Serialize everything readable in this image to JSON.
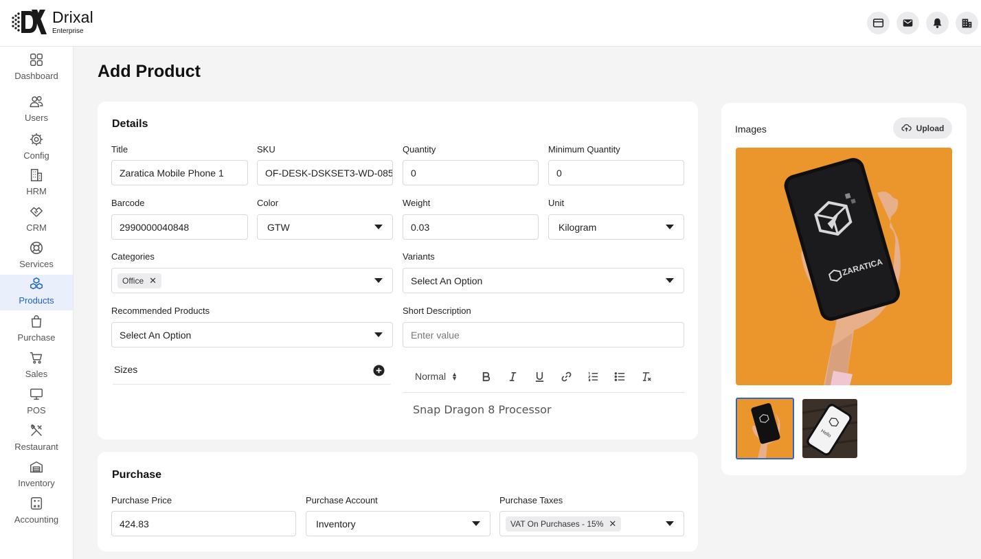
{
  "app": {
    "name": "Drixal",
    "edition": "Enterprise"
  },
  "top_icons": [
    "browser-window-icon",
    "mail-icon",
    "bell-icon",
    "company-building-icon"
  ],
  "sidebar": {
    "items": [
      {
        "label": "Dashboard",
        "icon": "dashboard-grid-icon"
      },
      {
        "label": "Users",
        "icon": "users-icon"
      },
      {
        "label": "Config",
        "icon": "config-gear-icon"
      },
      {
        "label": "HRM",
        "icon": "hrm-building-icon"
      },
      {
        "label": "CRM",
        "icon": "crm-handshake-icon"
      },
      {
        "label": "Services",
        "icon": "services-lifebuoy-icon"
      },
      {
        "label": "Products",
        "icon": "products-boxes-icon",
        "active": true
      },
      {
        "label": "Purchase",
        "icon": "purchase-bag-icon"
      },
      {
        "label": "Sales",
        "icon": "sales-cart-icon"
      },
      {
        "label": "POS",
        "icon": "pos-monitor-icon"
      },
      {
        "label": "Restaurant",
        "icon": "restaurant-utensils-icon"
      },
      {
        "label": "Inventory",
        "icon": "inventory-warehouse-icon"
      },
      {
        "label": "Accounting",
        "icon": "accounting-calculator-icon"
      }
    ]
  },
  "page": {
    "title": "Add Product"
  },
  "details": {
    "heading": "Details",
    "title": {
      "label": "Title",
      "value": "Zaratica Mobile Phone 1"
    },
    "sku": {
      "label": "SKU",
      "value": "OF-DESK-DSKSET3-WD-085"
    },
    "quantity": {
      "label": "Quantity",
      "value": "0"
    },
    "min_quantity": {
      "label": "Minimum Quantity",
      "value": "0"
    },
    "barcode": {
      "label": "Barcode",
      "value": "2990000040848"
    },
    "color": {
      "label": "Color",
      "value": "GTW"
    },
    "weight": {
      "label": "Weight",
      "value": "0.03"
    },
    "unit": {
      "label": "Unit",
      "value": "Kilogram"
    },
    "categories": {
      "label": "Categories",
      "chips": [
        "Office"
      ]
    },
    "variants": {
      "label": "Variants",
      "placeholder": "Select An Option"
    },
    "recommended": {
      "label": "Recommended Products",
      "placeholder": "Select An Option"
    },
    "short_description": {
      "label": "Short Description",
      "placeholder": "Enter value"
    },
    "sizes": {
      "label": "Sizes"
    },
    "editor": {
      "format": "Normal",
      "content": "Snap Dragon 8 Processor"
    }
  },
  "purchase": {
    "heading": "Purchase",
    "price": {
      "label": "Purchase Price",
      "value": "424.83"
    },
    "account": {
      "label": "Purchase Account",
      "value": "Inventory"
    },
    "taxes": {
      "label": "Purchase Taxes",
      "chips": [
        "VAT On Purchases - 15%"
      ]
    }
  },
  "images": {
    "heading": "Images",
    "upload_label": "Upload",
    "brand_text": "ZARATICA",
    "thumb_text": "Hello",
    "colors": {
      "main_bg": "#ea962d",
      "accent": "#2a66cf"
    }
  }
}
